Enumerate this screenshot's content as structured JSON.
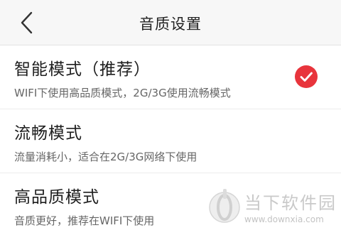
{
  "header": {
    "title": "音质设置",
    "back_icon": "chevron-left-icon"
  },
  "options": [
    {
      "title": "智能模式（推荐）",
      "description": "WIFI下使用高品质模式，2G/3G使用流畅模式",
      "selected": true
    },
    {
      "title": "流畅模式",
      "description": "流量消耗小，适合在2G/3G网络下使用",
      "selected": false
    },
    {
      "title": "高品质模式",
      "description": "音质更好，推荐在WIFI下使用",
      "selected": false
    }
  ],
  "watermark": {
    "name": "当下软件园",
    "url": "www.downxia.com"
  },
  "colors": {
    "accent": "#e8343c",
    "header_bg": "#f7f7f7",
    "row_bg": "#ffffff",
    "text_primary": "#1e1e1e",
    "text_secondary": "#666666"
  }
}
